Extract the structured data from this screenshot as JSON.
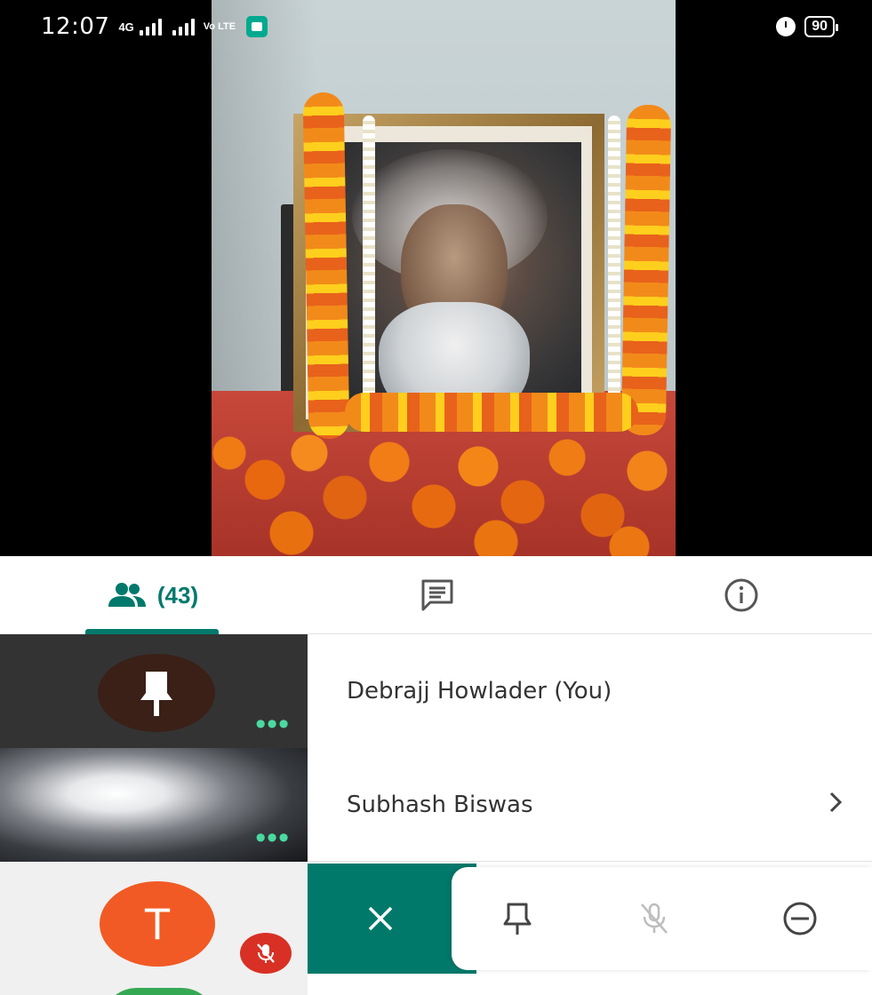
{
  "status_bar": {
    "time": "12:07",
    "network_type": "4G",
    "volte": "Vo LTE",
    "battery": "90"
  },
  "tabs": {
    "people_count": "(43)",
    "accent_color": "#00796b"
  },
  "participants": [
    {
      "name": "Debrajj Howlader (You)"
    },
    {
      "name": "Subhash Biswas",
      "chevron": ">"
    }
  ],
  "tiles": {
    "t_initial": "T"
  },
  "action_bar": {
    "icons": [
      "close-icon",
      "pin-icon",
      "mic-off-icon",
      "remove-icon"
    ]
  }
}
